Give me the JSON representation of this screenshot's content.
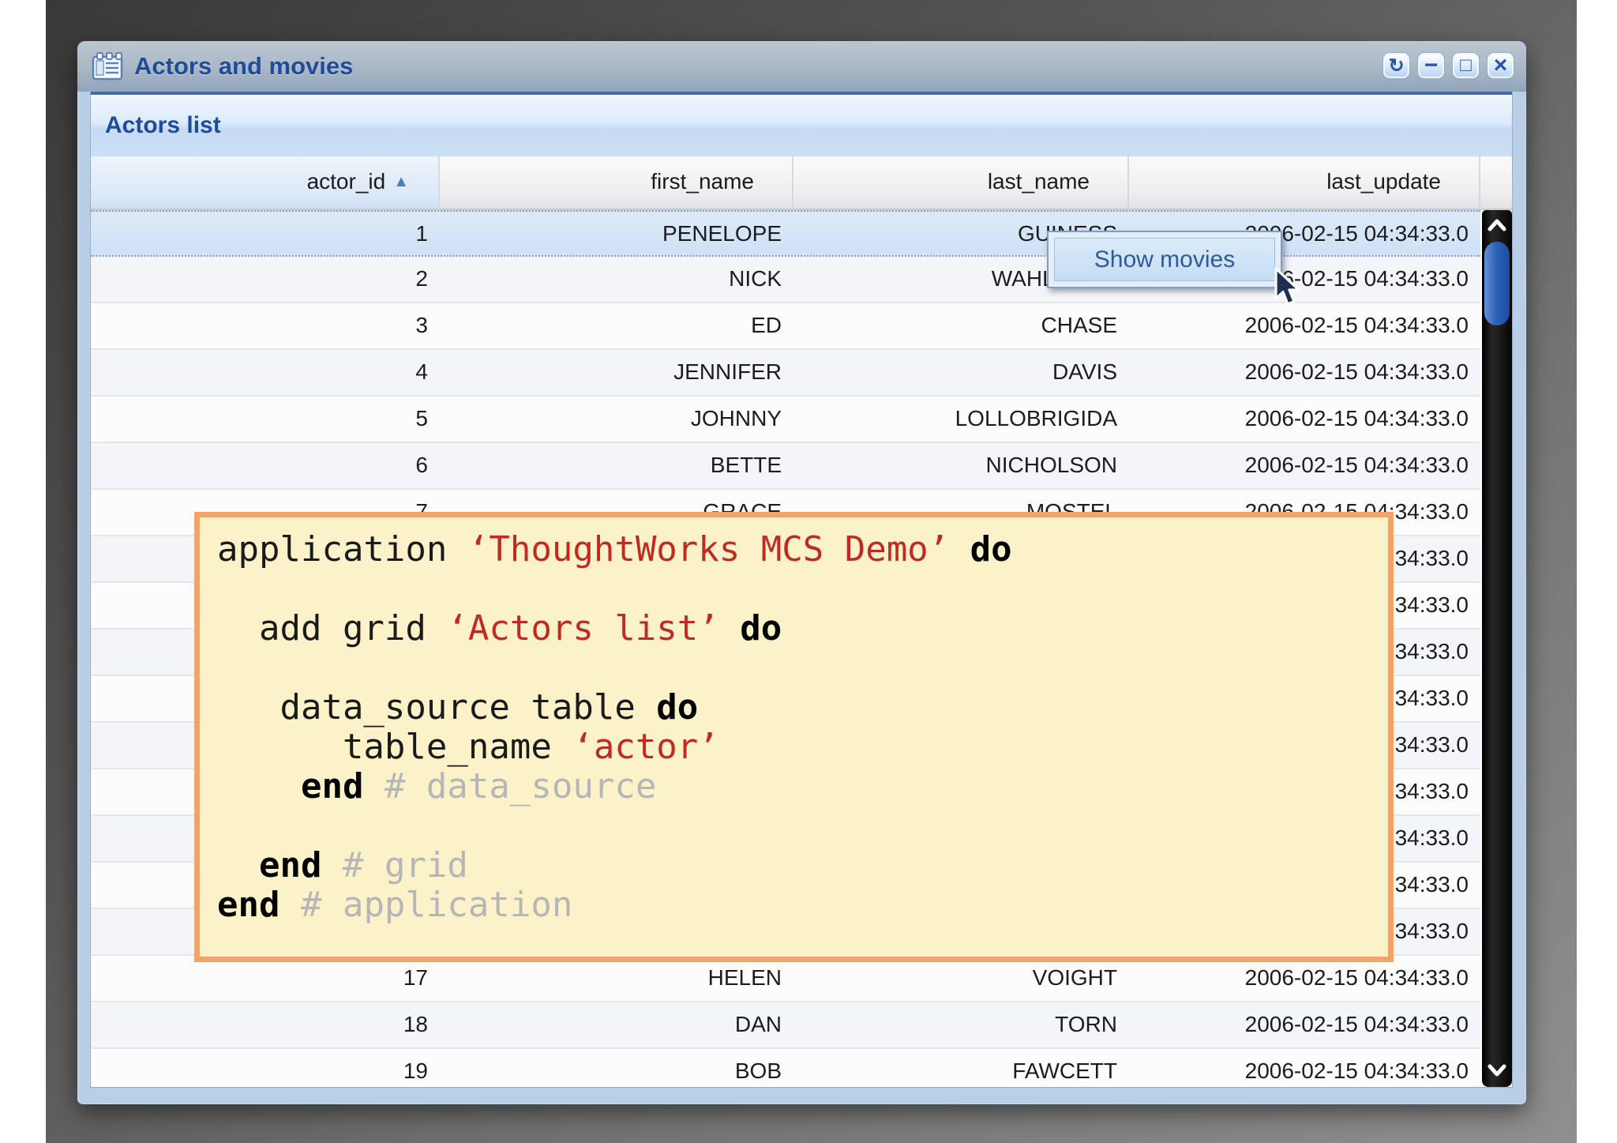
{
  "window": {
    "title": "Actors and movies",
    "controls": [
      {
        "name": "refresh",
        "glyph": "↻"
      },
      {
        "name": "minimize",
        "glyph": "−"
      },
      {
        "name": "maximize",
        "glyph": "□"
      },
      {
        "name": "close",
        "glyph": "×"
      }
    ]
  },
  "panel": {
    "title": "Actors list"
  },
  "table": {
    "sort_arrow": "▲",
    "columns": [
      {
        "label": "actor_id",
        "sorted": true,
        "sort_dir": "asc"
      },
      {
        "label": "first_name"
      },
      {
        "label": "last_name"
      },
      {
        "label": "last_update"
      }
    ],
    "rows": [
      {
        "actor_id": "1",
        "first_name": "PENELOPE",
        "last_name": "GUINESS",
        "last_update": "2006-02-15 04:34:33.0",
        "selected": true
      },
      {
        "actor_id": "2",
        "first_name": "NICK",
        "last_name": "WAHLBERG",
        "last_update": "2006-02-15 04:34:33.0"
      },
      {
        "actor_id": "3",
        "first_name": "ED",
        "last_name": "CHASE",
        "last_update": "2006-02-15 04:34:33.0"
      },
      {
        "actor_id": "4",
        "first_name": "JENNIFER",
        "last_name": "DAVIS",
        "last_update": "2006-02-15 04:34:33.0"
      },
      {
        "actor_id": "5",
        "first_name": "JOHNNY",
        "last_name": "LOLLOBRIGIDA",
        "last_update": "2006-02-15 04:34:33.0"
      },
      {
        "actor_id": "6",
        "first_name": "BETTE",
        "last_name": "NICHOLSON",
        "last_update": "2006-02-15 04:34:33.0"
      },
      {
        "actor_id": "7",
        "first_name": "GRACE",
        "last_name": "MOSTEL",
        "last_update": "2006-02-15 04:34:33.0"
      },
      {
        "actor_id": "",
        "first_name": "",
        "last_name": "",
        "last_update": "2006-02-15 04:34:33.0",
        "covered": true
      },
      {
        "actor_id": "",
        "first_name": "",
        "last_name": "",
        "last_update": "2006-02-15 04:34:33.0",
        "covered": true
      },
      {
        "actor_id": "",
        "first_name": "",
        "last_name": "",
        "last_update": "2006-02-15 04:34:33.0",
        "covered": true
      },
      {
        "actor_id": "",
        "first_name": "",
        "last_name": "",
        "last_update": "2006-02-15 04:34:33.0",
        "covered": true
      },
      {
        "actor_id": "",
        "first_name": "",
        "last_name": "",
        "last_update": "2006-02-15 04:34:33.0",
        "covered": true
      },
      {
        "actor_id": "",
        "first_name": "",
        "last_name": "",
        "last_update": "2006-02-15 04:34:33.0",
        "covered": true
      },
      {
        "actor_id": "",
        "first_name": "",
        "last_name": "",
        "last_update": "2006-02-15 04:34:33.0",
        "covered": true
      },
      {
        "actor_id": "",
        "first_name": "",
        "last_name": "",
        "last_update": "2006-02-15 04:34:33.0",
        "covered": true
      },
      {
        "actor_id": "",
        "first_name": "",
        "last_name": "",
        "last_update": "2006-02-15 04:34:33.0",
        "covered": true
      },
      {
        "actor_id": "17",
        "first_name": "HELEN",
        "last_name": "VOIGHT",
        "last_update": "2006-02-15 04:34:33.0"
      },
      {
        "actor_id": "18",
        "first_name": "DAN",
        "last_name": "TORN",
        "last_update": "2006-02-15 04:34:33.0"
      },
      {
        "actor_id": "19",
        "first_name": "BOB",
        "last_name": "FAWCETT",
        "last_update": "2006-02-15 04:34:33.0"
      }
    ]
  },
  "context_menu": {
    "items": [
      {
        "label": "Show movies",
        "highlighted": true
      }
    ]
  },
  "code_overlay": {
    "lines": [
      {
        "segments": [
          {
            "text": "application ",
            "type": "plain"
          },
          {
            "text": "‘ThoughtWorks MCS Demo’",
            "type": "string"
          },
          {
            "text": " ",
            "type": "plain"
          },
          {
            "text": "do",
            "type": "keyword"
          }
        ]
      },
      {
        "segments": []
      },
      {
        "segments": [
          {
            "text": "  add grid ",
            "type": "plain"
          },
          {
            "text": "‘Actors list’",
            "type": "string"
          },
          {
            "text": " ",
            "type": "plain"
          },
          {
            "text": "do",
            "type": "keyword"
          }
        ]
      },
      {
        "segments": []
      },
      {
        "segments": [
          {
            "text": "   data_source table ",
            "type": "plain"
          },
          {
            "text": "do",
            "type": "keyword"
          }
        ]
      },
      {
        "segments": [
          {
            "text": "      table_name ",
            "type": "plain"
          },
          {
            "text": "‘actor’",
            "type": "string"
          }
        ]
      },
      {
        "segments": [
          {
            "text": "    ",
            "type": "plain"
          },
          {
            "text": "end",
            "type": "keyword"
          },
          {
            "text": " # data_source",
            "type": "comment"
          }
        ]
      },
      {
        "segments": []
      },
      {
        "segments": [
          {
            "text": "  ",
            "type": "plain"
          },
          {
            "text": "end",
            "type": "keyword"
          },
          {
            "text": " # grid",
            "type": "comment"
          }
        ]
      },
      {
        "segments": [
          {
            "text": "end",
            "type": "keyword"
          },
          {
            "text": " # application",
            "type": "comment"
          }
        ]
      }
    ]
  },
  "colors": {
    "title_blue": "#1e4b9a",
    "band_blue": "#1d4c9b",
    "selection_bg": "#d9e7f8",
    "code_string": "#bf2b20",
    "code_comment": "#b6b6b6",
    "code_box_bg": "#fbf2ca",
    "code_box_border": "#f1a469",
    "scroll_thumb": "#2f63b8",
    "popup_text": "#2f5a94"
  }
}
